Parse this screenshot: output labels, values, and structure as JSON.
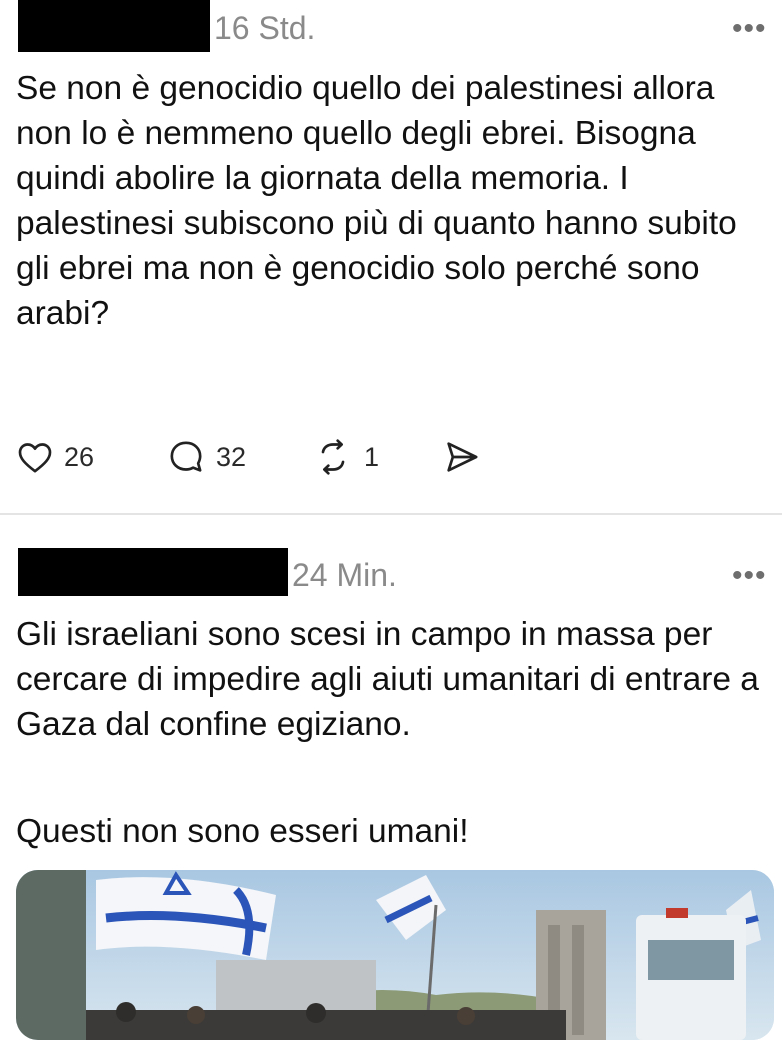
{
  "posts": [
    {
      "timestamp": "16 Std.",
      "more_label": "•••",
      "text": "Se non è genocidio quello dei palestinesi allora non lo è nemmeno quello degli ebrei. Bisogna quindi abolire la giornata della memoria. I palestinesi subiscono più di quanto hanno subito gli ebrei ma non è genocidio solo perché sono arabi?",
      "actions": {
        "likes": "26",
        "replies": "32",
        "reposts": "1"
      }
    },
    {
      "timestamp": "24 Min.",
      "more_label": "•••",
      "text": "Gli israeliani sono scesi in campo in massa per cercare di impedire agli aiuti umanitari di entrare a Gaza dal confine egiziano.",
      "text2": "Questi non sono esseri umani!"
    }
  ],
  "icons": [
    "heart-icon",
    "reply-icon",
    "repost-icon",
    "share-icon",
    "more-icon"
  ],
  "colors": {
    "text": "#111111",
    "muted": "#8a8a8a",
    "divider": "#e4e4e4"
  }
}
